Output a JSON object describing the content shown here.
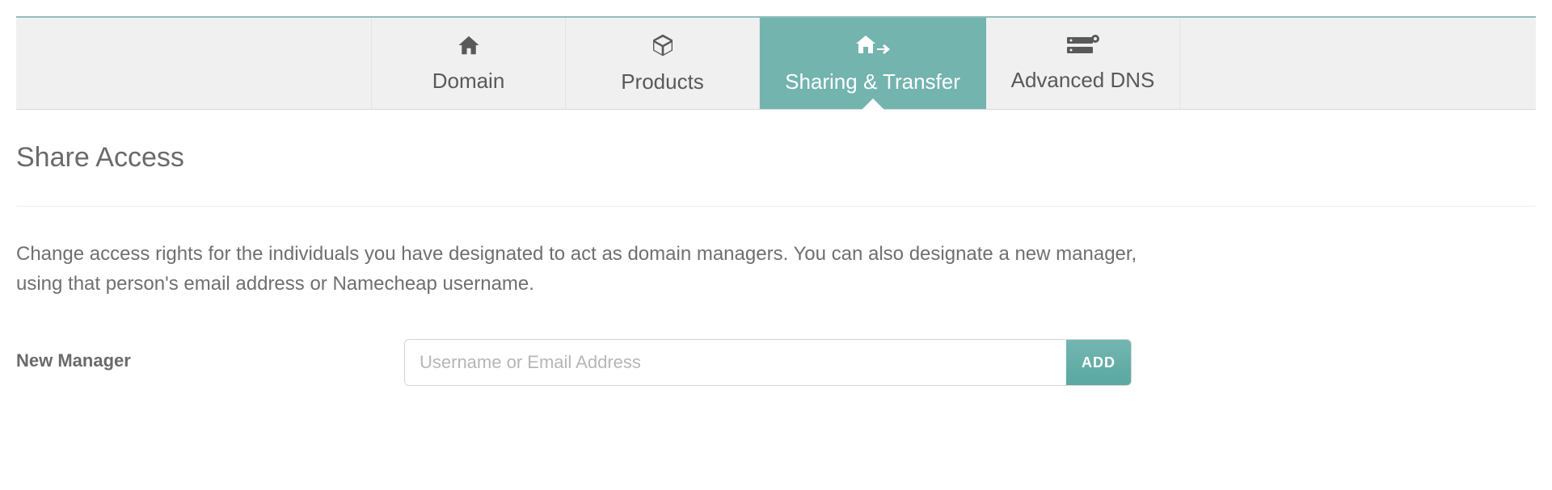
{
  "tabs": {
    "domain": {
      "label": "Domain"
    },
    "products": {
      "label": "Products"
    },
    "sharing": {
      "label": "Sharing & Transfer"
    },
    "dns": {
      "label": "Advanced DNS"
    }
  },
  "active_tab": "sharing",
  "section": {
    "title": "Share Access",
    "description": "Change access rights for the individuals you have designated to act as domain managers. You can also designate a new manager, using that person's email address or Namecheap username."
  },
  "form": {
    "label": "New Manager",
    "placeholder": "Username or Email Address",
    "value": "",
    "button": "ADD"
  }
}
